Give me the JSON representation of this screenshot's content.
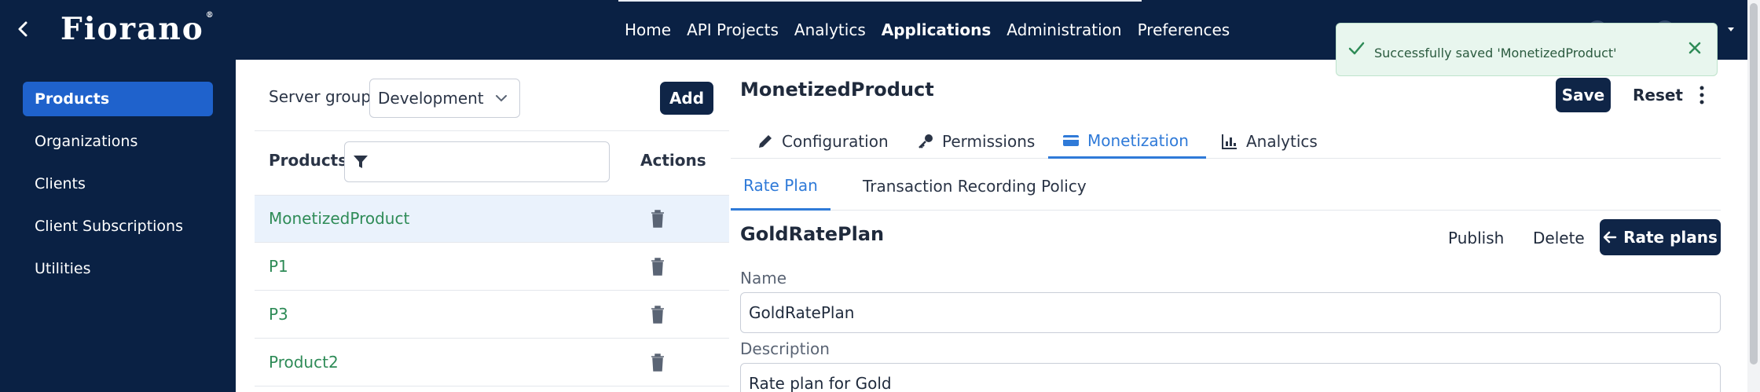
{
  "header": {
    "logo": "Fiorano",
    "logo_mark": "®",
    "nav": [
      "Home",
      "API Projects",
      "Analytics",
      "Applications",
      "Administration",
      "Preferences"
    ],
    "active_nav": "Applications"
  },
  "sidebar": {
    "items": [
      {
        "label": "Products",
        "active": true
      },
      {
        "label": "Organizations",
        "active": false
      },
      {
        "label": "Clients",
        "active": false
      },
      {
        "label": "Client Subscriptions",
        "active": false
      },
      {
        "label": "Utilities",
        "active": false
      }
    ]
  },
  "products_panel": {
    "server_group_label": "Server group",
    "server_group_value": "Development",
    "add_label": "Add",
    "col_products": "Products",
    "col_actions": "Actions",
    "filter_value": "",
    "products": [
      {
        "name": "MonetizedProduct",
        "selected": true
      },
      {
        "name": "P1",
        "selected": false
      },
      {
        "name": "P3",
        "selected": false
      },
      {
        "name": "Product2",
        "selected": false
      }
    ]
  },
  "detail": {
    "title": "MonetizedProduct",
    "save_label": "Save",
    "reset_label": "Reset",
    "tabs": [
      {
        "label": "Configuration",
        "icon": "pencil-icon"
      },
      {
        "label": "Permissions",
        "icon": "key-icon"
      },
      {
        "label": "Monetization",
        "icon": "credit-card-icon"
      },
      {
        "label": "Analytics",
        "icon": "bar-chart-icon"
      }
    ],
    "active_tab": "Monetization",
    "subtabs": [
      "Rate Plan",
      "Transaction Recording Policy"
    ],
    "active_subtab": "Rate Plan",
    "plan": {
      "title": "GoldRatePlan",
      "publish_label": "Publish",
      "delete_label": "Delete",
      "rate_plans_label": "Rate plans",
      "name_label": "Name",
      "name_value": "GoldRatePlan",
      "description_label": "Description",
      "description_value": "Rate plan for Gold"
    }
  },
  "toast": {
    "message": "Successfully saved 'MonetizedProduct'",
    "type": "success"
  },
  "colors": {
    "navy": "#0a2144",
    "primary_button": "#0f2547",
    "active_sidebar": "#1f62cc",
    "accent_blue": "#2f7ad8",
    "product_link": "#2e8b57",
    "toast_bg": "#e8f6ee"
  }
}
